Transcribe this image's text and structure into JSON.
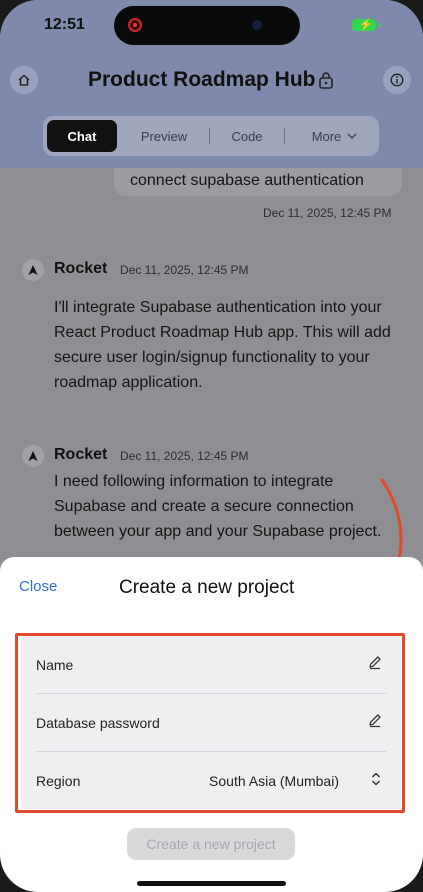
{
  "status_bar": {
    "time": "12:51"
  },
  "header": {
    "title": "Product Roadmap Hub"
  },
  "tabs": [
    {
      "label": "Chat"
    },
    {
      "label": "Preview"
    },
    {
      "label": "Code"
    },
    {
      "label": "More"
    }
  ],
  "chat": {
    "user_message": {
      "text": "connect supabase authentication",
      "time": "Dec 11, 2025, 12:45 PM"
    },
    "messages": [
      {
        "sender": "Rocket",
        "time": "Dec 11, 2025, 12:45 PM",
        "text": "I'll integrate Supabase authentication into your React Product Roadmap Hub app. This will add secure user login/signup functionality to your roadmap application."
      },
      {
        "sender": "Rocket",
        "time": "Dec 11, 2025, 12:45 PM",
        "text": "I need following information to integrate Supabase and create a secure connection between your app and your Supabase project."
      }
    ]
  },
  "sheet": {
    "close_label": "Close",
    "title": "Create a new project",
    "fields": [
      {
        "label": "Name",
        "value": ""
      },
      {
        "label": "Database password",
        "value": ""
      },
      {
        "label": "Region",
        "value": "South Asia (Mumbai)"
      }
    ],
    "create_label": "Create a new project"
  },
  "colors": {
    "accent": "#2f6fd6",
    "annotation": "#e14b2b",
    "battery": "#32d74b"
  }
}
